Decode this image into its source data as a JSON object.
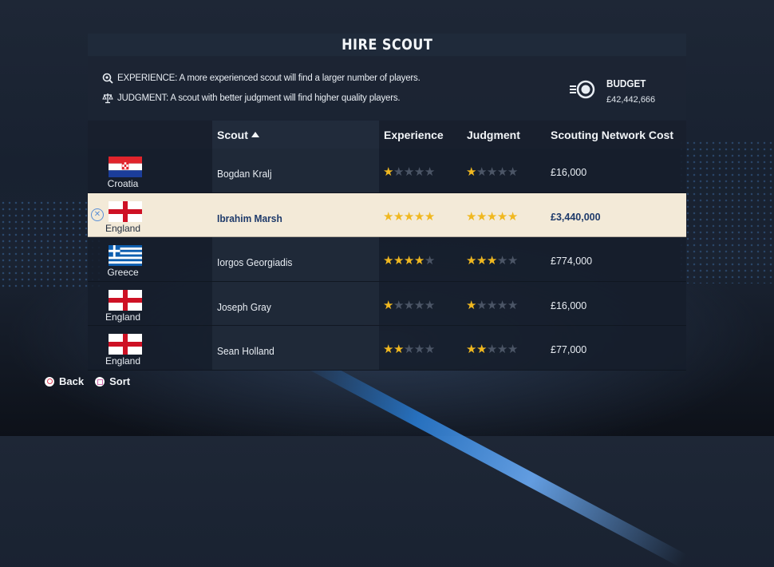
{
  "screen": {
    "title": "HIRE SCOUT"
  },
  "info": {
    "experience": "EXPERIENCE: A more experienced scout will find a larger number of players.",
    "judgment": "JUDGMENT: A scout with better judgment will find higher quality players."
  },
  "budget": {
    "label": "BUDGET",
    "value": "£42,442,666"
  },
  "table": {
    "headers": {
      "scout": "Scout",
      "experience": "Experience",
      "judgment": "Judgment",
      "cost": "Scouting Network Cost"
    },
    "sort": {
      "column": "Scout",
      "direction": "ascending"
    },
    "rows": [
      {
        "country": "Croatia",
        "flag": "croatia-flag-icon",
        "name": "Bogdan Kralj",
        "experience": 1,
        "judgment": 1,
        "cost": "£16,000",
        "selected": false
      },
      {
        "country": "England",
        "flag": "england-flag-icon",
        "name": "Ibrahim Marsh",
        "experience": 5,
        "judgment": 5,
        "cost": "£3,440,000",
        "selected": true
      },
      {
        "country": "Greece",
        "flag": "greece-flag-icon",
        "name": "Iorgos Georgiadis",
        "experience": 4,
        "judgment": 3,
        "cost": "£774,000",
        "selected": false
      },
      {
        "country": "England",
        "flag": "england-flag-icon",
        "name": "Joseph Gray",
        "experience": 1,
        "judgment": 1,
        "cost": "£16,000",
        "selected": false
      },
      {
        "country": "England",
        "flag": "england-flag-icon",
        "name": "Sean Holland",
        "experience": 2,
        "judgment": 2,
        "cost": "£77,000",
        "selected": false
      }
    ],
    "max_stars": 5
  },
  "footer": {
    "back_label": "Back",
    "sort_label": "Sort"
  },
  "colors": {
    "star_on": "#f0b820",
    "star_off": "#4b5566",
    "selected_row": "#f3ead8"
  }
}
